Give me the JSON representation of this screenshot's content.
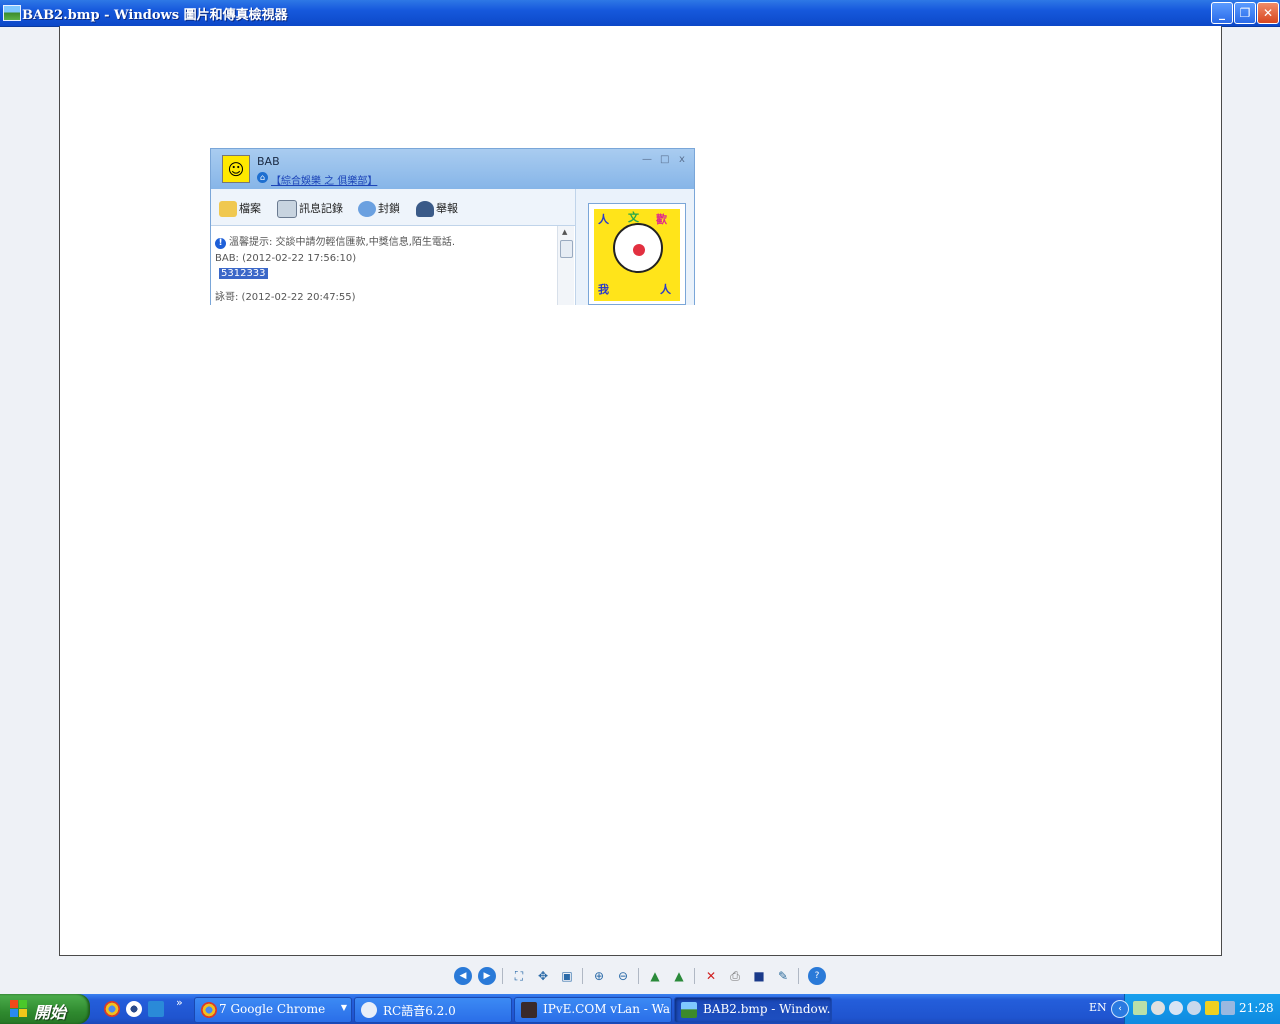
{
  "window": {
    "title": "BAB2.bmp - Windows 圖片和傳真檢視器"
  },
  "chat": {
    "contact_name": "BAB",
    "group_link": "【綜合娛樂 之 俱樂部】",
    "toolbar": {
      "file_label": "檔案",
      "history_label": "訊息記錄",
      "block_label": "封鎖",
      "report_label": "舉報"
    },
    "messages": {
      "notice": "溫馨提示: 交談中請勿輕信匯款,中獎信息,陌生電話.",
      "msg1_header": "BAB: (2012-02-22 17:56:10)",
      "msg1_body": "5312333",
      "msg2_header": "詠哥: (2012-02-22 20:47:55)"
    }
  },
  "viewer_toolbar": {
    "icons": [
      "previous-image-icon",
      "next-image-icon",
      "best-fit-icon",
      "actual-size-icon",
      "slideshow-icon",
      "zoom-in-icon",
      "zoom-out-icon",
      "rotate-clockwise-icon",
      "rotate-counterclockwise-icon",
      "delete-icon",
      "print-icon",
      "save-icon",
      "edit-icon",
      "help-icon"
    ]
  },
  "taskbar": {
    "start_label": "開始",
    "tasks": [
      {
        "label": "7 Google Chrome"
      },
      {
        "label": "RC語音6.2.0"
      },
      {
        "label": "IPvE.COM vLan - Wa..."
      },
      {
        "label": "BAB2.bmp - Window..."
      }
    ],
    "language": "EN",
    "clock": "21:28"
  },
  "colors": {
    "title_bar": "#1658dc",
    "taskbar": "#245edb",
    "start_button": "#2f8a2f",
    "tray": "#0f8ae0"
  }
}
